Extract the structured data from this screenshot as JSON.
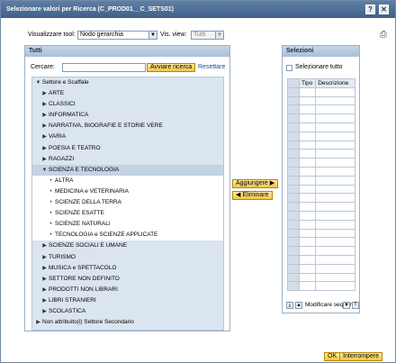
{
  "window": {
    "title": "Selezionare valori per Ricerca (C_PROD01__C_SETS01)",
    "help": "?",
    "close": "✕"
  },
  "tool": {
    "label": "Visualizzare tool:",
    "value": "Nodo gerarchia",
    "view_label": "Vis. view:",
    "view_value": "Tutti",
    "export_icon": "export-icon"
  },
  "left": {
    "title": "Tutti",
    "search_label": "Cercare:",
    "search_value": "",
    "search_button": "Avviare ricerca",
    "reset": "Resettare",
    "tree": [
      {
        "label": "Settore  e Scaffale",
        "icon": "▼",
        "indent": 0
      },
      {
        "label": "ARTE",
        "icon": "▶",
        "indent": 1
      },
      {
        "label": "CLASSICI",
        "icon": "▶",
        "indent": 1
      },
      {
        "label": "INFORMATICA",
        "icon": "▶",
        "indent": 1
      },
      {
        "label": "NARRATIVA, BIOGRAFIE E STORIE VERE",
        "icon": "▶",
        "indent": 1
      },
      {
        "label": "VARIA",
        "icon": "▶",
        "indent": 1
      },
      {
        "label": "POESIA E TEATRO",
        "icon": "▶",
        "indent": 1
      },
      {
        "label": "RAGAZZI",
        "icon": "▶",
        "indent": 1
      },
      {
        "label": "SCIENZA E TECNOLOGIA",
        "icon": "▼",
        "indent": 1
      },
      {
        "label": "ALTRA",
        "icon": "•",
        "indent": 2
      },
      {
        "label": "MEDICINA e VETERINARIA",
        "icon": "•",
        "indent": 2
      },
      {
        "label": "SCIENZE DELLA TERRA",
        "icon": "•",
        "indent": 2
      },
      {
        "label": "SCIENZE ESATTE",
        "icon": "•",
        "indent": 2
      },
      {
        "label": "SCIENZE NATURALI",
        "icon": "•",
        "indent": 2
      },
      {
        "label": "TECNOLOGIA e SCIENZE APPLICATE",
        "icon": "•",
        "indent": 2
      },
      {
        "label": "SCIENZE SOCIALI E UMANE",
        "icon": "▶",
        "indent": 1
      },
      {
        "label": "TURISMO",
        "icon": "▶",
        "indent": 1
      },
      {
        "label": "MUSICA e SPETTACOLO",
        "icon": "▶",
        "indent": 1
      },
      {
        "label": "SETTORE NON DEFINITO",
        "icon": "▶",
        "indent": 1
      },
      {
        "label": "PRODOTTI NON LIBRARI",
        "icon": "▶",
        "indent": 1
      },
      {
        "label": "LIBRI STRANIERI",
        "icon": "▶",
        "indent": 1
      },
      {
        "label": "SCOLASTICA",
        "icon": "▶",
        "indent": 1
      },
      {
        "label": "Non attribuito(i) Settore Secondario",
        "icon": "▶",
        "indent": 0
      }
    ]
  },
  "middle": {
    "add": "Aggiungere",
    "remove": "Eliminare"
  },
  "right": {
    "title": "Selezioni",
    "select_all": "Selezionare tutto",
    "col_type": "Tipo",
    "col_desc": "Descrizione",
    "modify": "Modificare sequenza"
  },
  "footer": {
    "ok": "OK",
    "cancel": "Interrompere"
  }
}
